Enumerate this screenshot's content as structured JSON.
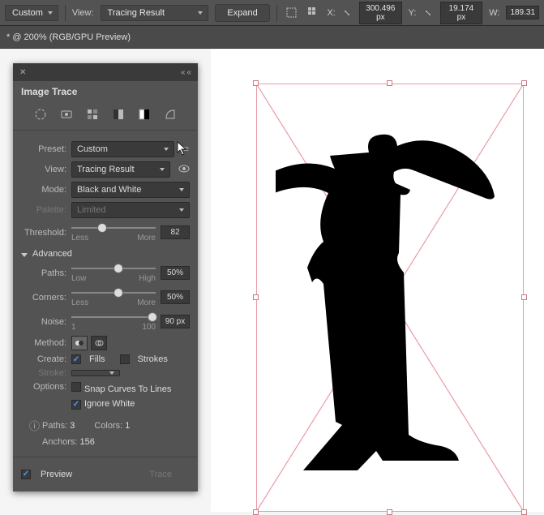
{
  "topbar": {
    "preset_dd": "Custom",
    "view_label": "View:",
    "view_dd": "Tracing Result",
    "expand_btn": "Expand",
    "x_label": "X:",
    "x_val": "300.496 px",
    "y_label": "Y:",
    "y_val": "19.174 px",
    "w_label": "W:",
    "w_val": "189.31"
  },
  "tabstrip": {
    "title": "* @ 200% (RGB/GPU Preview)"
  },
  "panel": {
    "title": "Image Trace",
    "preset": {
      "label": "Preset:",
      "value": "Custom"
    },
    "view": {
      "label": "View:",
      "value": "Tracing Result"
    },
    "mode": {
      "label": "Mode:",
      "value": "Black and White"
    },
    "palette": {
      "label": "Palette:",
      "value": "Limited"
    },
    "threshold": {
      "label": "Threshold:",
      "value": "82",
      "lo": "Less",
      "hi": "More",
      "pct": 31
    },
    "advanced": "Advanced",
    "paths": {
      "label": "Paths:",
      "value": "50%",
      "lo": "Low",
      "hi": "High",
      "pct": 50
    },
    "corners": {
      "label": "Corners:",
      "value": "50%",
      "lo": "Less",
      "hi": "More",
      "pct": 50
    },
    "noise": {
      "label": "Noise:",
      "value": "90 px",
      "lo": "1",
      "hi": "100",
      "pct": 90
    },
    "method": {
      "label": "Method:"
    },
    "create": {
      "label": "Create:",
      "fills": "Fills",
      "strokes": "Strokes"
    },
    "stroke": {
      "label": "Stroke:"
    },
    "options": {
      "label": "Options:",
      "snap": "Snap Curves To Lines",
      "ignore": "Ignore White"
    },
    "info": {
      "paths_l": "Paths:",
      "paths_v": "3",
      "colors_l": "Colors:",
      "colors_v": "1",
      "anchors_l": "Anchors:",
      "anchors_v": "156"
    },
    "preview": "Preview",
    "trace": "Trace"
  }
}
